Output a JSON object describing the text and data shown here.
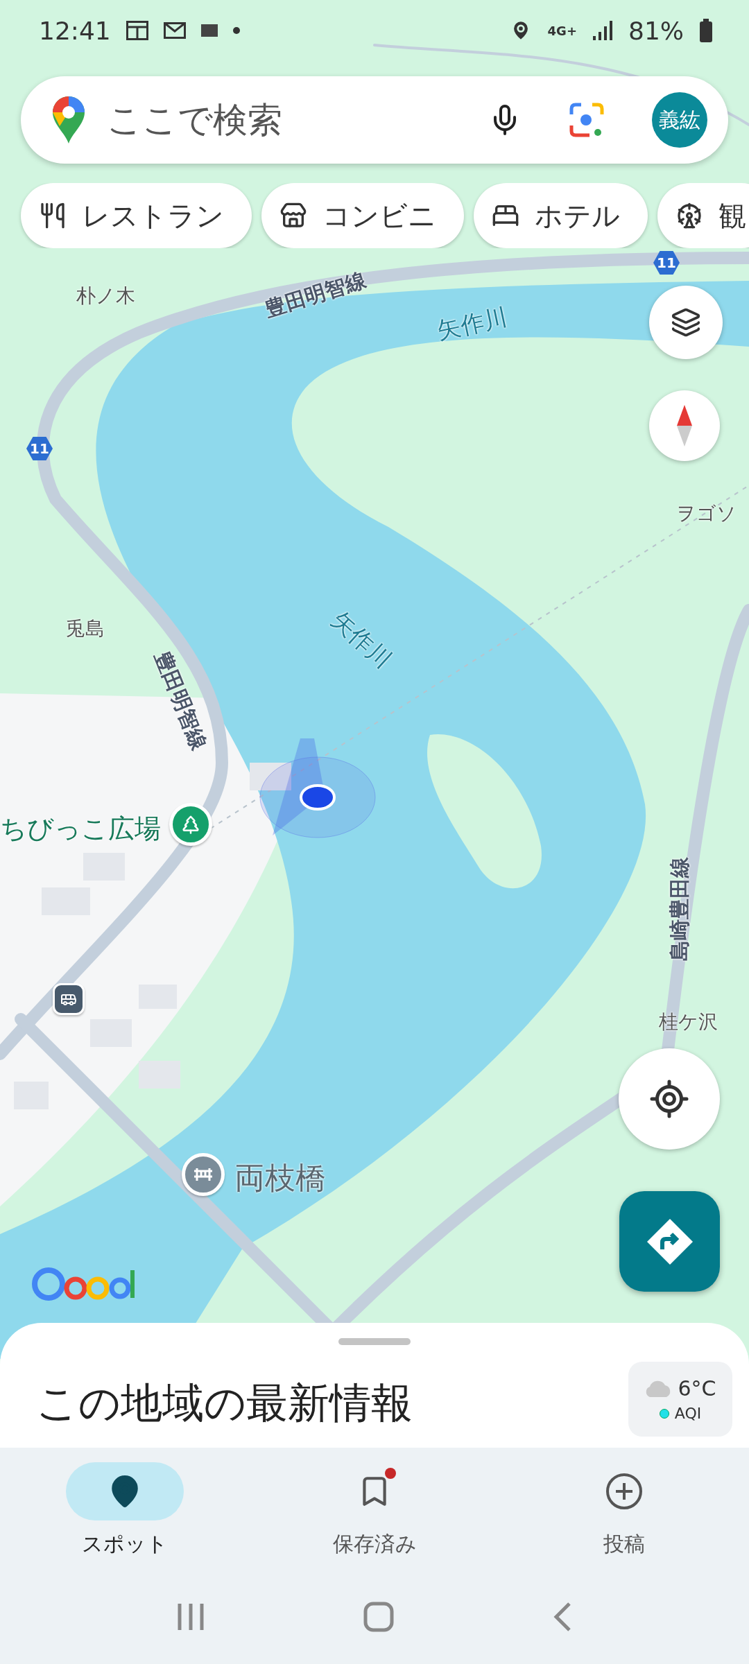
{
  "status_bar": {
    "time": "12:41",
    "network": "4G+",
    "battery": "81%"
  },
  "search": {
    "placeholder": "ここで検索",
    "avatar": "義紘"
  },
  "chips": [
    {
      "label": "レストラン"
    },
    {
      "label": "コンビニ"
    },
    {
      "label": "ホテル"
    },
    {
      "label": "観"
    }
  ],
  "map_labels": [
    {
      "text": "朴ノ木",
      "kind": "place"
    },
    {
      "text": "豊田明智線",
      "kind": "road"
    },
    {
      "text": "矢作川",
      "kind": "river"
    },
    {
      "text": "11",
      "kind": "shield"
    },
    {
      "text": "11",
      "kind": "shield"
    },
    {
      "text": "ヲゴソ",
      "kind": "place"
    },
    {
      "text": "兎島",
      "kind": "place"
    },
    {
      "text": "矢作川",
      "kind": "river"
    },
    {
      "text": "豊田明智線",
      "kind": "road"
    },
    {
      "text": "ちびっこ広場",
      "kind": "park"
    },
    {
      "text": "島崎豊田線",
      "kind": "road"
    },
    {
      "text": "桂ケ沢",
      "kind": "place"
    },
    {
      "text": "両枝橋",
      "kind": "bridge"
    }
  ],
  "sheet": {
    "title": "この地域の最新情報",
    "temperature": "6°C",
    "aqi": "AQI"
  },
  "nav": [
    {
      "label": "スポット",
      "selected": true,
      "badge": false
    },
    {
      "label": "保存済み",
      "selected": false,
      "badge": true
    },
    {
      "label": "投稿",
      "selected": false,
      "badge": false
    }
  ]
}
